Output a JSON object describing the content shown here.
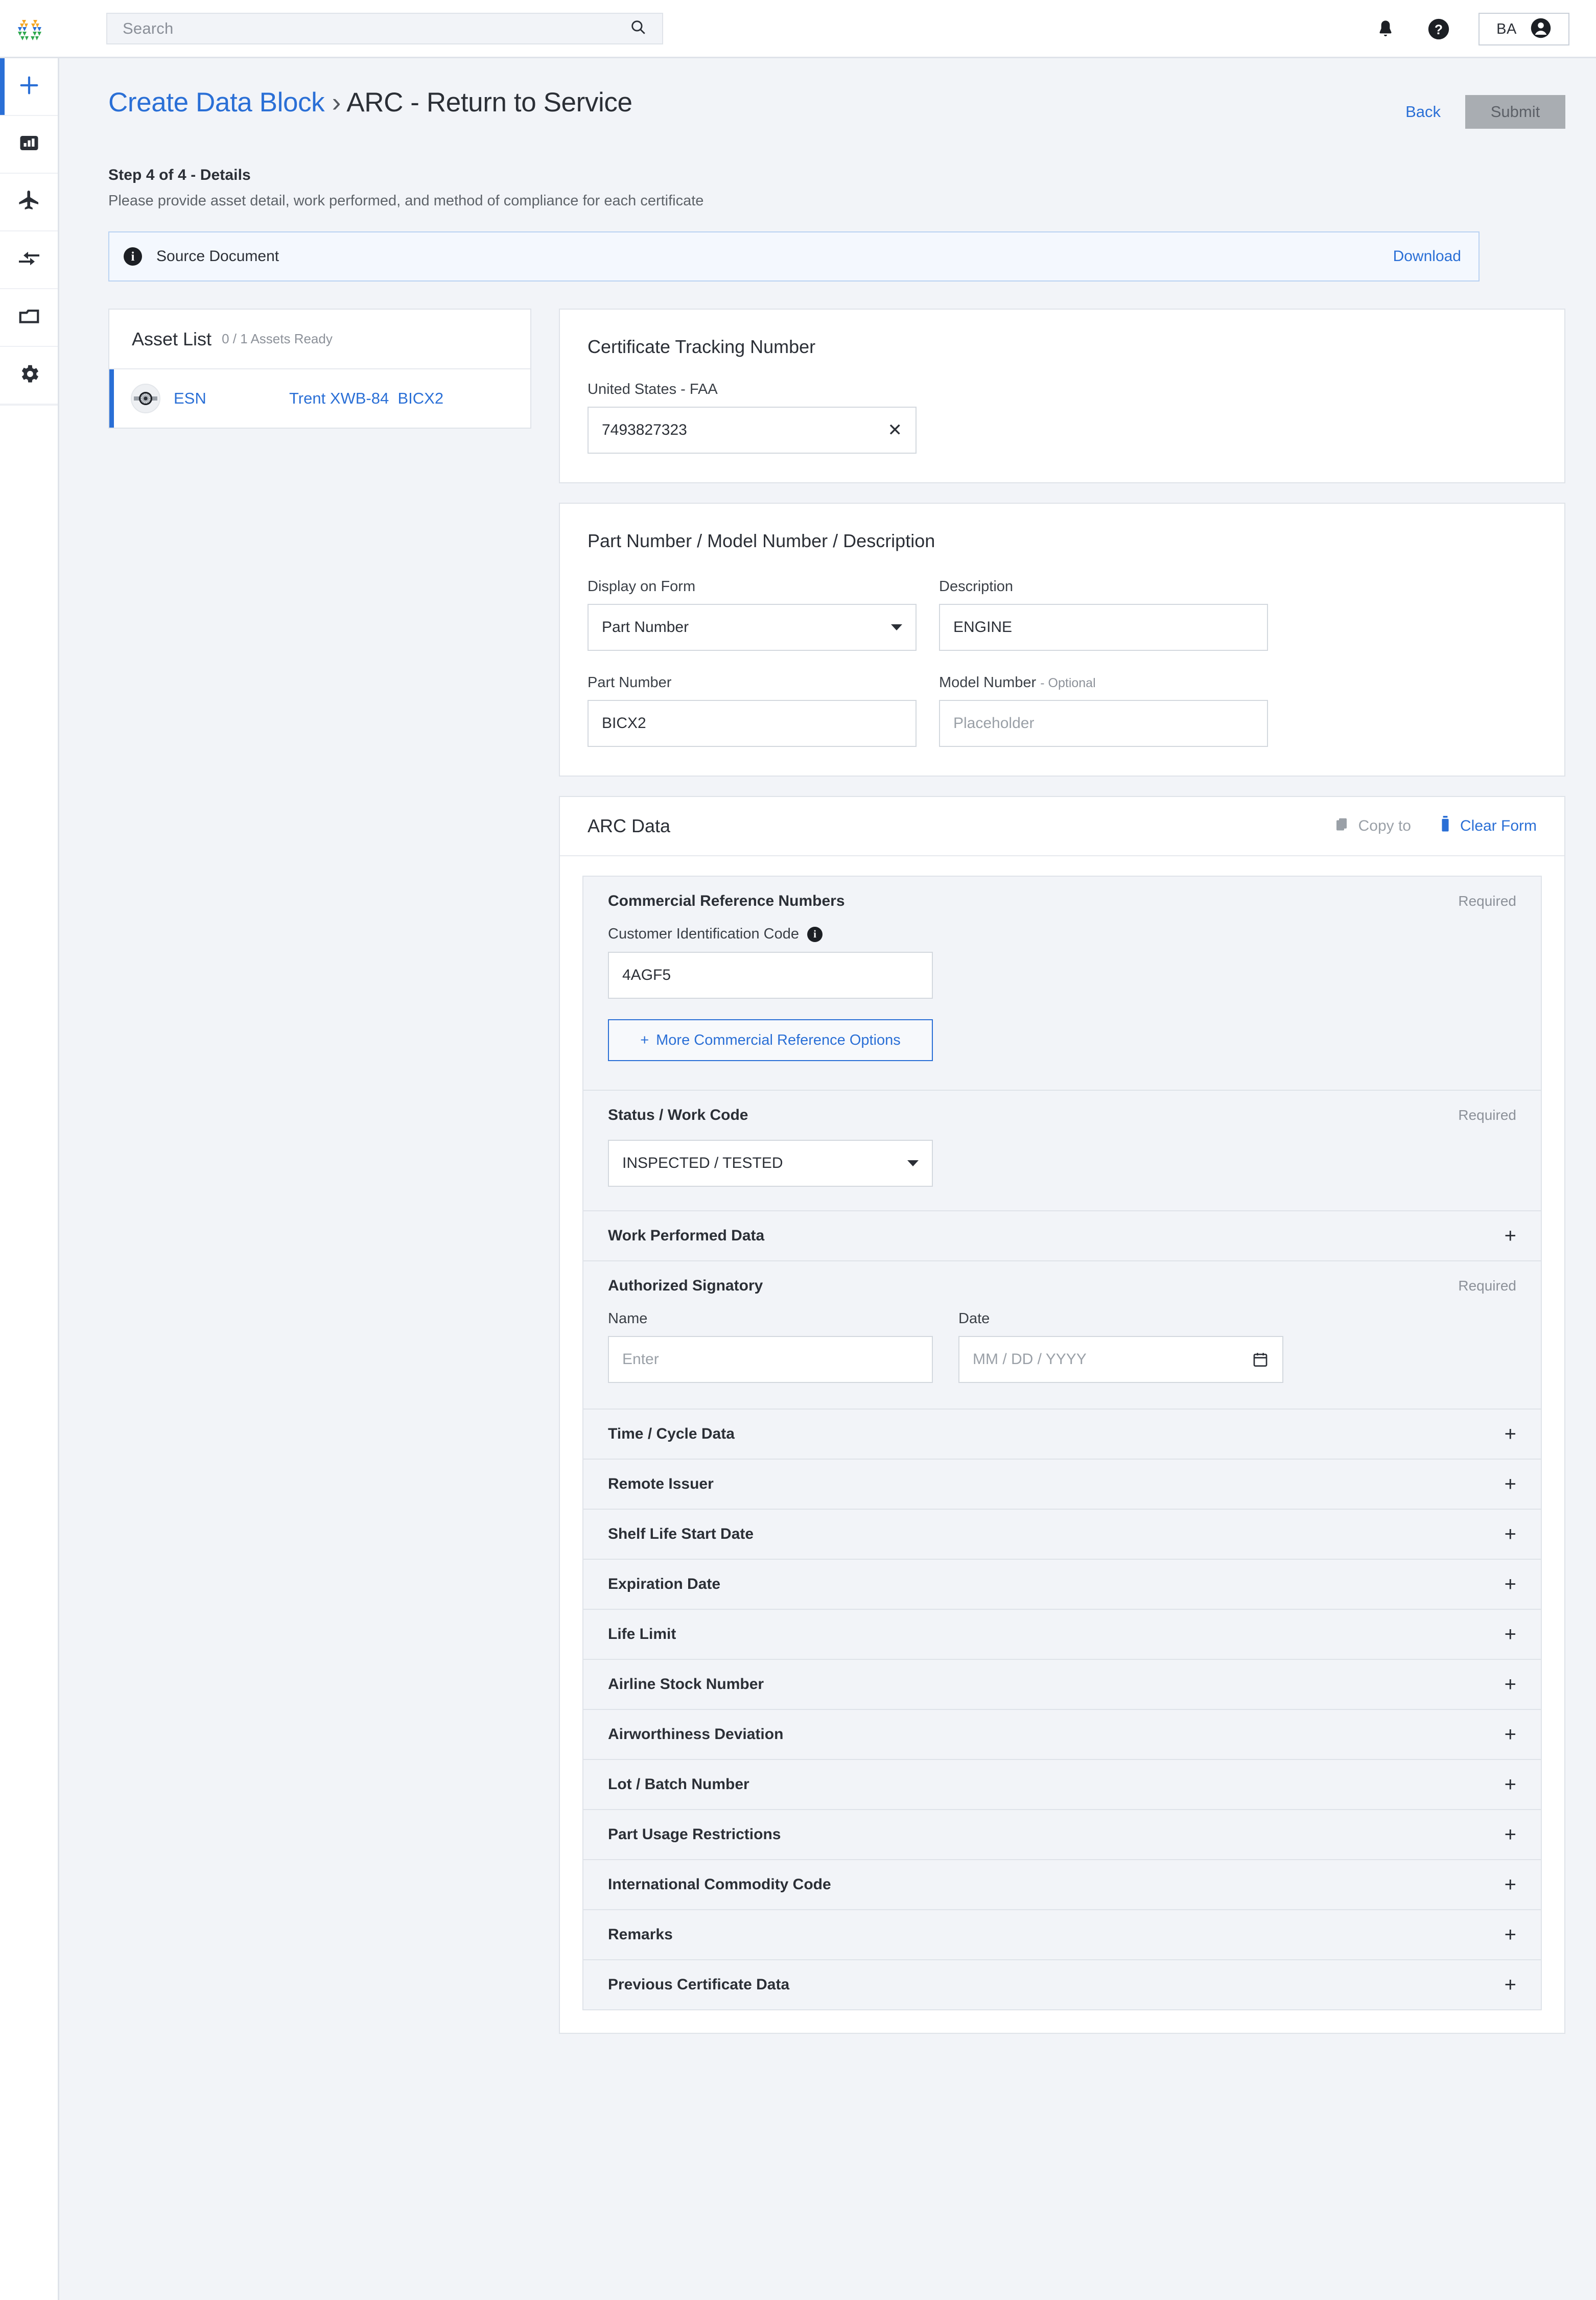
{
  "topbar": {
    "logo_name": "ge-aerospace-logo",
    "search": {
      "placeholder": "Search"
    },
    "notifications_label": "Notifications",
    "help_label": "Help",
    "account_initials": "BA"
  },
  "sidebar": {
    "items": [
      {
        "icon": "plus-icon",
        "name": "create",
        "active": true
      },
      {
        "icon": "bar-chart-icon",
        "name": "analytics",
        "active": false
      },
      {
        "icon": "airplane-icon",
        "name": "fleet",
        "active": false
      },
      {
        "icon": "compare-arrows-icon",
        "name": "transfers",
        "active": false
      },
      {
        "icon": "folder-icon",
        "name": "documents",
        "active": false
      },
      {
        "icon": "gear-icon",
        "name": "settings",
        "active": false
      }
    ]
  },
  "header": {
    "breadcrumb_link": "Create Data Block",
    "breadcrumb_sep": "›",
    "breadcrumb_current": "ARC - Return to Service",
    "back_label": "Back",
    "submit_label": "Submit",
    "step_title": "Step 4 of 4 - Details",
    "step_subtitle": "Please provide asset detail, work performed, and method of compliance for each certificate"
  },
  "source_document": {
    "label": "Source Document",
    "download_label": "Download"
  },
  "asset_list": {
    "title": "Asset List",
    "count_label": "0 / 1 Assets Ready",
    "rows": [
      {
        "type": "ESN",
        "model": "Trent XWB-84",
        "part": "BICX2",
        "avatar_icon": "engine-icon"
      }
    ]
  },
  "certificate_tracking": {
    "title": "Certificate Tracking Number",
    "authority_label": "United States - FAA",
    "value": "7493827323",
    "clear_glyph": "✕"
  },
  "part_number_card": {
    "title": "Part Number / Model Number / Description",
    "display_on_form": {
      "label": "Display on Form",
      "value": "Part Number"
    },
    "description": {
      "label": "Description",
      "value": "ENGINE"
    },
    "part_number": {
      "label": "Part Number",
      "value": "BICX2"
    },
    "model_number": {
      "label": "Model Number",
      "optional": "- Optional",
      "placeholder": "Placeholder",
      "value": ""
    }
  },
  "arc_data": {
    "title": "ARC Data",
    "copy_to_label": "Copy to",
    "clear_form_label": "Clear Form",
    "commercial_reference": {
      "title": "Commercial Reference Numbers",
      "required_label": "Required",
      "customer_id_label": "Customer Identification Code",
      "customer_id_value": "4AGF5",
      "more_options_label": "More Commercial Reference Options",
      "more_options_plus": "+"
    },
    "status_work_code": {
      "title": "Status / Work Code",
      "required_label": "Required",
      "value": "INSPECTED / TESTED"
    },
    "work_performed": {
      "title": "Work Performed Data",
      "expand_glyph": "+"
    },
    "authorized_signatory": {
      "title": "Authorized Signatory",
      "required_label": "Required",
      "name_label": "Name",
      "name_placeholder": "Enter",
      "name_value": "",
      "date_label": "Date",
      "date_placeholder": "MM / DD / YYYY",
      "date_value": ""
    },
    "collapsed_sections": [
      {
        "title": "Time / Cycle Data",
        "glyph": "+"
      },
      {
        "title": "Remote Issuer",
        "glyph": "+"
      },
      {
        "title": "Shelf Life Start Date",
        "glyph": "+"
      },
      {
        "title": "Expiration Date",
        "glyph": "+"
      },
      {
        "title": "Life Limit",
        "glyph": "+"
      },
      {
        "title": "Airline Stock Number",
        "glyph": "+"
      },
      {
        "title": "Airworthiness Deviation",
        "glyph": "+"
      },
      {
        "title": "Lot / Batch Number",
        "glyph": "+"
      },
      {
        "title": "Part Usage Restrictions",
        "glyph": "+"
      },
      {
        "title": "International Commodity Code",
        "glyph": "+"
      },
      {
        "title": "Remarks",
        "glyph": "+"
      },
      {
        "title": "Previous Certificate Data",
        "glyph": "+"
      }
    ]
  },
  "colors": {
    "accent_blue": "#2a6fd6",
    "page_bg": "#f2f4f8",
    "card_bg": "#ffffff",
    "border": "#dfe3e9",
    "muted_text": "#8c9199",
    "submit_disabled_bg": "#a9adb2",
    "info_banner_bg": "#f4f8fe",
    "info_banner_border": "#b9d2f2"
  }
}
